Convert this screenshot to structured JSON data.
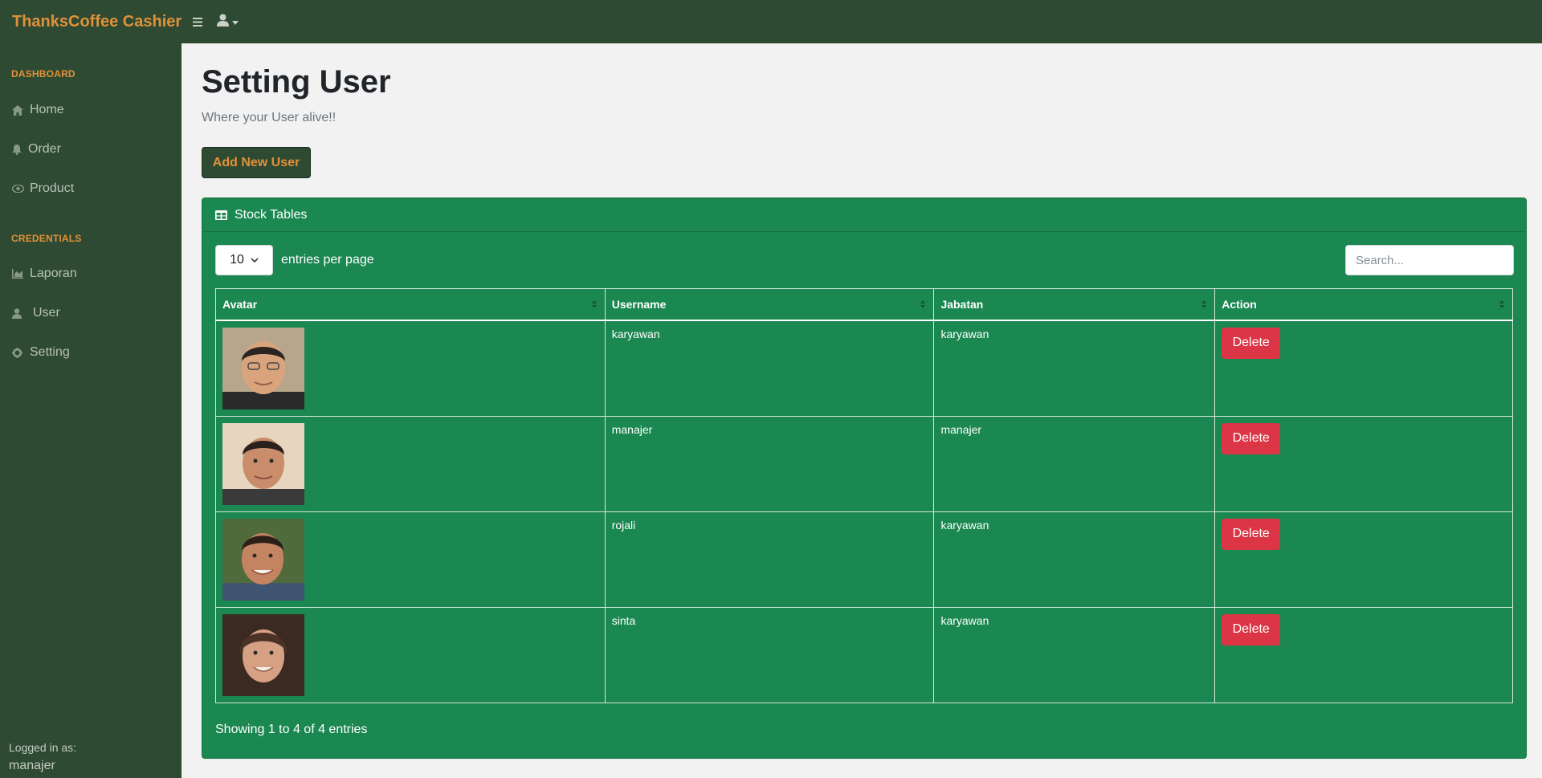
{
  "app": {
    "brand": "ThanksCoffee Cashier"
  },
  "topbar": {
    "toggle_icon": "bars-icon",
    "user_icon": "user-icon"
  },
  "sidebar": {
    "sections": [
      {
        "heading": "DASHBOARD",
        "items": [
          {
            "label": "Home",
            "icon": "home-icon"
          },
          {
            "label": "Order",
            "icon": "bell-icon"
          },
          {
            "label": "Product",
            "icon": "eye-icon"
          }
        ]
      },
      {
        "heading": "CREDENTIALS",
        "items": [
          {
            "label": "Laporan",
            "icon": "chart-area-icon"
          },
          {
            "label": "User",
            "icon": "user-icon"
          },
          {
            "label": "Setting",
            "icon": "gear-icon"
          }
        ]
      }
    ],
    "footer": {
      "label": "Logged in as:",
      "user": "manajer"
    }
  },
  "main": {
    "title": "Setting User",
    "subtitle": "Where your User alive!!",
    "add_button": "Add New User"
  },
  "card": {
    "title": "Stock Tables",
    "icon": "table-icon",
    "entries_value": "10",
    "entries_label": "entries per page",
    "search_placeholder": "Search...",
    "columns": [
      "Avatar",
      "Username",
      "Jabatan",
      "Action"
    ],
    "rows": [
      {
        "avatar": "avatar-photo",
        "username": "karyawan",
        "jabatan": "karyawan",
        "action": "Delete"
      },
      {
        "avatar": "avatar-photo",
        "username": "manajer",
        "jabatan": "manajer",
        "action": "Delete"
      },
      {
        "avatar": "avatar-photo",
        "username": "rojali",
        "jabatan": "karyawan",
        "action": "Delete"
      },
      {
        "avatar": "avatar-photo",
        "username": "sinta",
        "jabatan": "karyawan",
        "action": "Delete"
      }
    ],
    "footer": "Showing 1 to 4 of 4 entries"
  },
  "colors": {
    "nav_bg": "#2f4a32",
    "brand_accent": "#e0913a",
    "card_bg": "#1b8751",
    "delete_btn": "#dc3545"
  }
}
